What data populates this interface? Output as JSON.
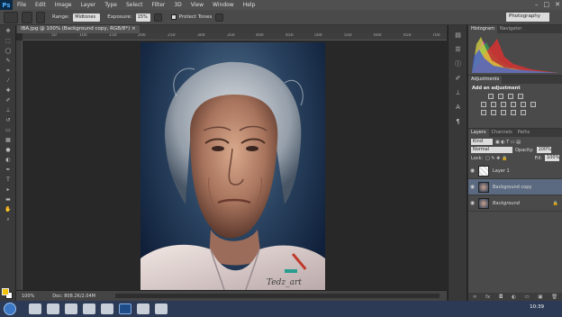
{
  "app": {
    "logo": "Ps"
  },
  "menu": [
    "File",
    "Edit",
    "Image",
    "Layer",
    "Type",
    "Select",
    "Filter",
    "3D",
    "View",
    "Window",
    "Help"
  ],
  "options": {
    "range_label": "Range:",
    "range_value": "Midtones",
    "exposure_label": "Exposure:",
    "exposure_value": "15%",
    "protect_label": "Protect Tones",
    "workspace": "Photography"
  },
  "document": {
    "tab_label": "IBA.jpg @ 100% (Background copy, RGB/8*)",
    "zoom": "100%",
    "doc_info": "Doc: 808.2K/2.04M",
    "watermark": "Tedz_art"
  },
  "ruler": {
    "ticks": [
      "50",
      "100",
      "150",
      "200",
      "250",
      "300",
      "350",
      "400",
      "450",
      "500",
      "550",
      "600",
      "650",
      "700"
    ]
  },
  "panels": {
    "histogram_tabs": [
      "Histogram",
      "Navigator"
    ],
    "adjustments_tab": "Adjustments",
    "adjustments_title": "Add an adjustment",
    "layers_tabs": [
      "Layers",
      "Channels",
      "Paths"
    ],
    "kind_label": "Kind",
    "blend_mode": "Normal",
    "opacity_label": "Opacity:",
    "opacity_value": "100%",
    "lock_label": "Lock:",
    "fill_label": "Fill:",
    "fill_value": "100%",
    "layers": [
      {
        "name": "Layer 1",
        "selected": false
      },
      {
        "name": "Background copy",
        "selected": true
      },
      {
        "name": "Background",
        "selected": false
      }
    ]
  },
  "taskbar": {
    "time": "10:39"
  }
}
